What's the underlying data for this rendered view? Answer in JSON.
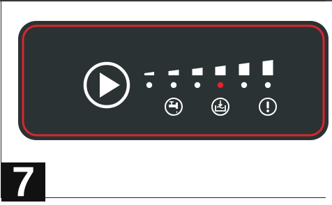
{
  "step": {
    "number": "7"
  },
  "panel": {
    "border_color": "#d8262e",
    "face_color": "#2b3233",
    "icon_color": "#ffffff"
  },
  "indicators": {
    "level_bars": 6,
    "lit_led_index": 3,
    "lit_led_color": "#e2232a",
    "unlit_led_color": "#ffffff",
    "icons": [
      {
        "below_led": 1,
        "name": "water-faucet-icon"
      },
      {
        "below_led": 3,
        "name": "water-level-icon"
      },
      {
        "below_led": 5,
        "name": "warning-icon"
      }
    ]
  },
  "play_button": {
    "name": "play-icon"
  }
}
